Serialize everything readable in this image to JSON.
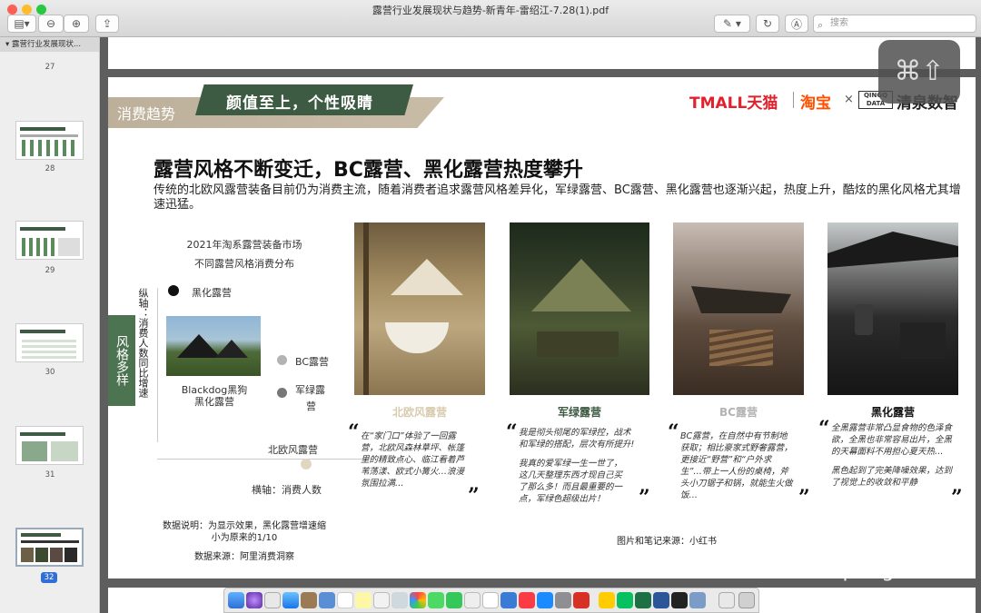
{
  "window": {
    "title": "露营行业发展现状与趋势-新青年-雷绍江-7.28(1).pdf",
    "search_placeholder": "搜索"
  },
  "sidebar": {
    "header": "露营行业发展现状...",
    "pages": [
      "27",
      "28",
      "29",
      "30",
      "31",
      "32"
    ],
    "selected": "32"
  },
  "slide": {
    "tag": "消费趋势",
    "banner": "颜值至上，个性吸睛",
    "brands": {
      "tmall": "TMALL天猫",
      "taobao": "淘宝",
      "times": "×",
      "qs": "清泉数智"
    },
    "headline": "露营风格不断变迁，BC露营、黑化露营热度攀升",
    "subline": "传统的北欧风露营装备目前仍为消费主流，随着消费者追求露营风格差异化，军绿露营、BC露营、黑化露营也逐渐兴起，热度上升，酷炫的黑化风格尤其增速迅猛。",
    "chart": {
      "title1": "2021年淘系露营装备市场",
      "title2": "不同露营风格消费分布",
      "side_tab": "风格多样",
      "ylabel": "纵轴：消费人数同比增速",
      "xlabel": "横轴：消费人数",
      "photo_caption1": "Blackdog黑狗",
      "photo_caption2": "黑化露营",
      "points": [
        {
          "label": "黑化露营",
          "color": "#111111"
        },
        {
          "label": "BC露营",
          "color": "#b3b3b3"
        },
        {
          "label": "军绿露",
          "label2": "营",
          "color": "#777777"
        },
        {
          "label": "北欧风露营",
          "color": "#e0d6c2"
        }
      ],
      "note1": "数据说明：为显示效果，黑化露营增速缩",
      "note2": "小为原来的1/10",
      "source": "数据来源：阿里消费洞察"
    },
    "styles": [
      {
        "title": "北欧风露营",
        "color": "#d9cbb0",
        "lines": [
          "在“家门口”体验了一回露",
          "营，北欧风森林草坪、帐篷",
          "里的精致点心、临江看着芦",
          "苇荡漾、欧式小篝火…浪漫",
          "氛围拉满…"
        ]
      },
      {
        "title": "军绿露营",
        "color": "#3d5a42",
        "lines": [
          "我是彻头彻尾的军绿控，战术",
          "和军绿的搭配，层次有所提升!",
          "",
          "我真的爱军绿一生一世了，",
          "这几天整理东西才现自己买",
          "了那么多！而且最重要的一",
          "点，军绿色超级出片！"
        ]
      },
      {
        "title": "BC露营",
        "color": "#b3b3b3",
        "lines": [
          "BC露营，在自然中有节制地",
          "获取；相比豪家式野奢露营，",
          "更接近“野营”和“户外求",
          "生”…带上一人份的桌椅，斧",
          "头小刀锯子和锅，就能生火做",
          "饭…"
        ]
      },
      {
        "title": "黑化露营",
        "color": "#111111",
        "lines": [
          "全黑露营非常凸显食物的色泽食",
          "欲，全黑也非常容易出片，全黑",
          "的天幕面料不用担心夏天热…",
          "",
          "黑色起到了完美降噪效果，达到",
          "了视觉上的收敛和平静"
        ]
      }
    ],
    "image_source": "图片和笔记来源：小红书"
  },
  "watermark": "新青年spring"
}
